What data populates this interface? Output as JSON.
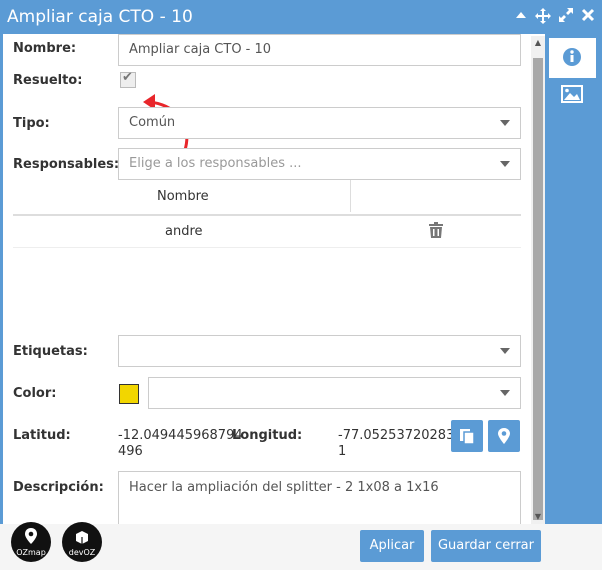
{
  "window": {
    "title": "Ampliar caja CTO - 10"
  },
  "form": {
    "nombre": {
      "label": "Nombre:",
      "value": "Ampliar caja CTO - 10"
    },
    "resuelto": {
      "label": "Resuelto:",
      "checked": true
    },
    "tipo": {
      "label": "Tipo:",
      "value": "Común"
    },
    "responsables": {
      "label": "Responsables:",
      "placeholder": "Elige a los responsables ..."
    },
    "table": {
      "header": "Nombre",
      "rows": [
        {
          "name": "andre"
        }
      ]
    },
    "etiquetas": {
      "label": "Etiquetas:",
      "value": ""
    },
    "color": {
      "label": "Color:",
      "swatch": "#f2d600",
      "value": ""
    },
    "latitud": {
      "label": "Latitud:",
      "value_line1": "-12.049445968794",
      "value_line2": "496"
    },
    "longitud": {
      "label": "Longitud:",
      "value_line1": "-77.052537202835",
      "value_line2": "1"
    },
    "descripcion": {
      "label": "Descripción:",
      "value": "Hacer la ampliación del splitter - 2 1x08 a 1x16"
    }
  },
  "footer": {
    "apply_label": "Aplicar",
    "save_close_label": "Guardar cerrar",
    "logo1_text": "OZmap",
    "logo2_text": "devOZ"
  },
  "colors": {
    "accent": "#5b9bd5",
    "swatch": "#f2d600",
    "arrow": "#e8262b"
  }
}
